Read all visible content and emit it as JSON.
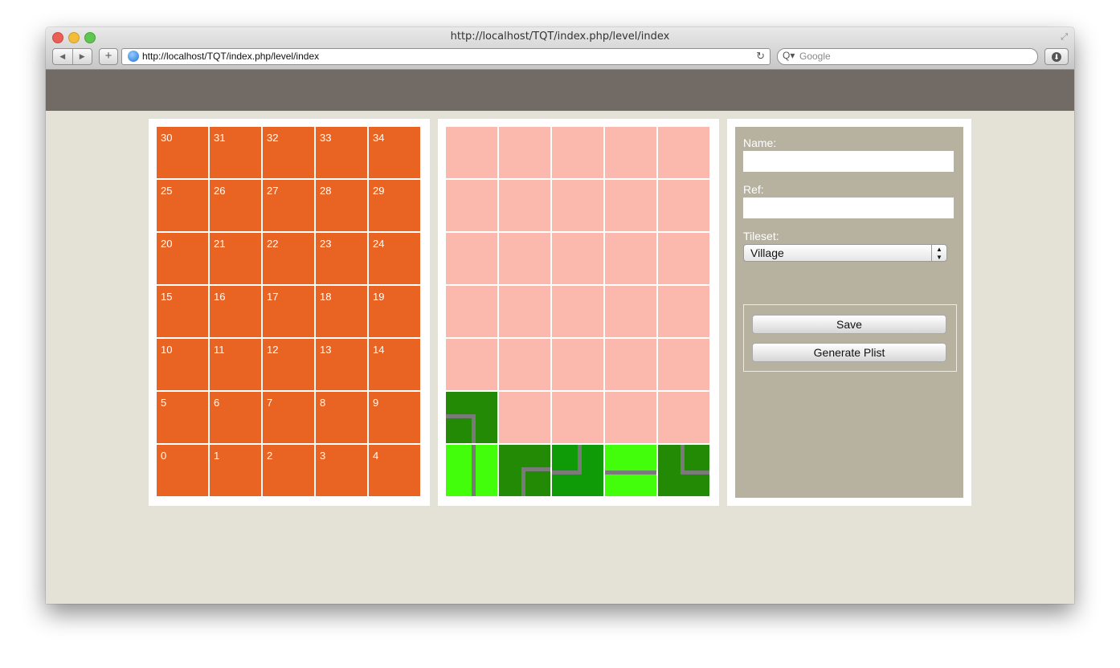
{
  "browser": {
    "window_title": "http://localhost/TQT/index.php/level/index",
    "url": "http://localhost/TQT/index.php/level/index",
    "search_placeholder": "Google",
    "back_glyph": "◀",
    "forward_glyph": "▶",
    "add_glyph": "+",
    "reload_glyph": "↻",
    "search_glyph": "Q▾",
    "download_glyph": "⬇",
    "resize_glyph": "⤢"
  },
  "number_grid": {
    "rows": [
      [
        "30",
        "31",
        "32",
        "33",
        "34"
      ],
      [
        "25",
        "26",
        "27",
        "28",
        "29"
      ],
      [
        "20",
        "21",
        "22",
        "23",
        "24"
      ],
      [
        "15",
        "16",
        "17",
        "18",
        "19"
      ],
      [
        "10",
        "11",
        "12",
        "13",
        "14"
      ],
      [
        "5",
        "6",
        "7",
        "8",
        "9"
      ],
      [
        "0",
        "1",
        "2",
        "3",
        "4"
      ]
    ],
    "cell_color": "#e96423"
  },
  "tile_map": {
    "empty_color": "#fbb8ad",
    "terrain_colors": {
      "dark": "#238a06",
      "mid": "#0e9b07",
      "light": "#43fe0b",
      "road": "#7a7a7a"
    },
    "placed_tiles": [
      {
        "row": 5,
        "col": 0,
        "terrain": "dark",
        "road": "corner-left-down"
      },
      {
        "row": 6,
        "col": 0,
        "terrain": "light",
        "road": "vertical"
      },
      {
        "row": 6,
        "col": 1,
        "terrain": "dark",
        "road": "corner-right-down"
      },
      {
        "row": 6,
        "col": 2,
        "terrain": "mid",
        "road": "corner-up-left"
      },
      {
        "row": 6,
        "col": 3,
        "terrain": "light",
        "road": "horizontal"
      },
      {
        "row": 6,
        "col": 4,
        "terrain": "dark",
        "road": "corner-up-right"
      }
    ]
  },
  "form": {
    "name_label": "Name:",
    "name_value": "",
    "ref_label": "Ref:",
    "ref_value": "",
    "tileset_label": "Tileset:",
    "tileset_selected": "Village",
    "tileset_arrows": "▲\n▼",
    "save_label": "Save",
    "generate_label": "Generate Plist"
  },
  "colors": {
    "header_bar": "#726a65",
    "page_background": "#e4e2d7",
    "form_panel": "#b7b19f"
  }
}
